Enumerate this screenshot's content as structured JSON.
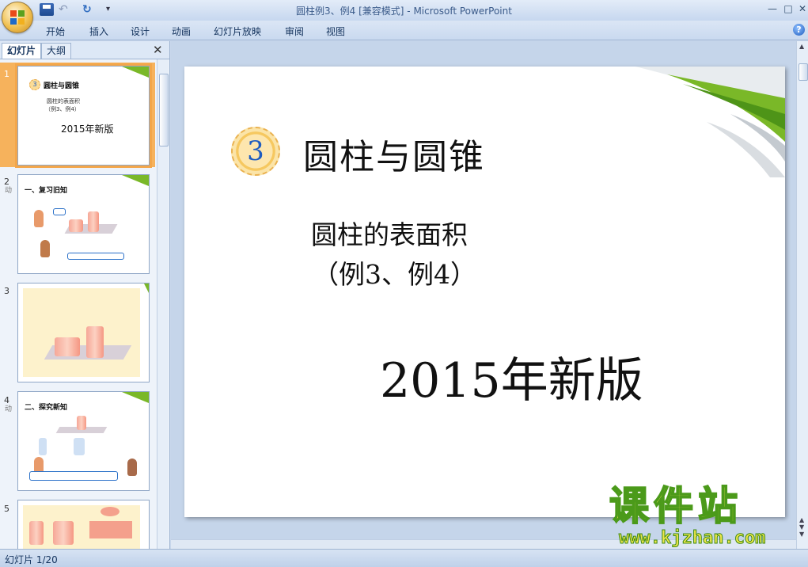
{
  "window": {
    "title": "圆柱例3、例4 [兼容模式] - Microsoft PowerPoint",
    "min_symbol": "—",
    "max_symbol": "□",
    "close_symbol": "✕"
  },
  "quick_access": {
    "undo": "↶",
    "redo": "↻",
    "more": "▾"
  },
  "ribbon": {
    "tabs": [
      "开始",
      "插入",
      "设计",
      "动画",
      "幻灯片放映",
      "审阅",
      "视图"
    ],
    "help": "?"
  },
  "panel": {
    "tabs": {
      "slides": "幻灯片",
      "outline": "大纲"
    },
    "close": "✕"
  },
  "thumbnails": [
    {
      "number": "1",
      "title": "圆柱与圆锥",
      "lines": [
        "圆柱的表面积",
        "（例3、例4）"
      ],
      "year": "2015年新版",
      "badge": "3"
    },
    {
      "number": "2",
      "title": "一、复习旧知",
      "anim": "动"
    },
    {
      "number": "3"
    },
    {
      "number": "4",
      "title": "二、探究新知",
      "anim": "动"
    },
    {
      "number": "5"
    }
  ],
  "slide": {
    "badge_number": "3",
    "title": "圆柱与圆锥",
    "subtitle_line1": "圆柱的表面积",
    "subtitle_line2": "（例3、例4）",
    "year": "2015年新版"
  },
  "status": {
    "slide_counter": "幻灯片 1/20"
  },
  "watermark": {
    "logo": "课件站",
    "url": "www.kjzhan.com"
  },
  "colors": {
    "accent_green": "#7ab828",
    "selection_orange": "#f3a64a",
    "badge_blue": "#1e5cc0"
  }
}
